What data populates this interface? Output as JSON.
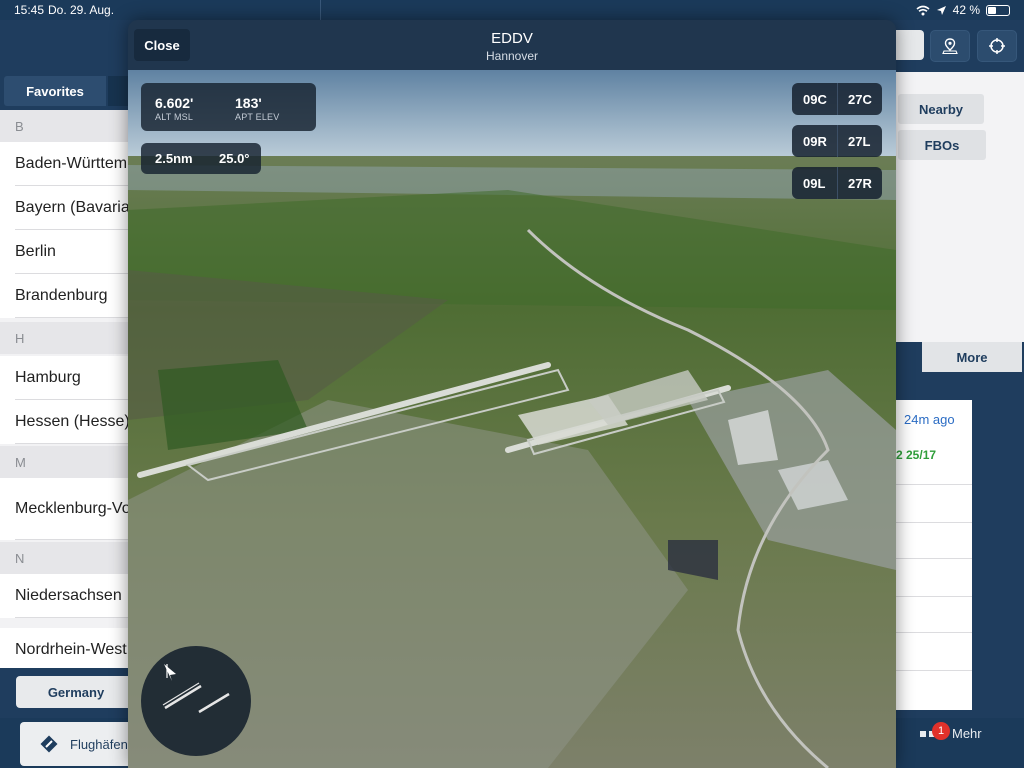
{
  "status_bar": {
    "time": "15:45",
    "date": "Do. 29. Aug.",
    "battery": "42 %"
  },
  "left_panel": {
    "segment_label": "Favorites",
    "sections": [
      {
        "header": "B",
        "rows": [
          "Baden-Württem",
          "Bayern (Bavaria",
          "Berlin",
          "Brandenburg"
        ]
      },
      {
        "header": "H",
        "rows": [
          "Hamburg",
          "Hessen (Hesse)"
        ]
      },
      {
        "header": "M",
        "rows": [
          "Mecklenburg-Vo"
        ]
      },
      {
        "header": "N",
        "rows": [
          "Niedersachsen",
          "Nordrhein-West"
        ]
      }
    ],
    "country_button": "Germany"
  },
  "right_panel": {
    "nearby": "Nearby",
    "fbos": "FBOs",
    "more": "More",
    "updated": "24m ago",
    "wind": "2 25/17"
  },
  "modal": {
    "close_label": "Close",
    "title": "EDDV",
    "subtitle": "Hannover",
    "alt_msl_value": "6.602'",
    "alt_msl_caption": "ALT MSL",
    "apt_elev_value": "183'",
    "apt_elev_caption": "APT ELEV",
    "distance": "2.5nm",
    "angle": "25.0°",
    "runways": [
      {
        "a": "09C",
        "b": "27C"
      },
      {
        "a": "09R",
        "b": "27L"
      },
      {
        "a": "09L",
        "b": "27R"
      }
    ]
  },
  "tab_bar": {
    "airports_label": "Flughäfen",
    "more_label": "Mehr",
    "badge_count": "1"
  },
  "colors": {
    "nav_dark": "#1f3d5e",
    "badge_red": "#e0312b",
    "link_blue": "#2b6cc4",
    "wind_green": "#2f9e3a"
  },
  "icons": [
    "wifi-icon",
    "location-arrow-icon",
    "battery-icon",
    "map-pin-icon",
    "crosshair-icon",
    "compass-icon",
    "airport-icon",
    "more-dots-icon"
  ]
}
